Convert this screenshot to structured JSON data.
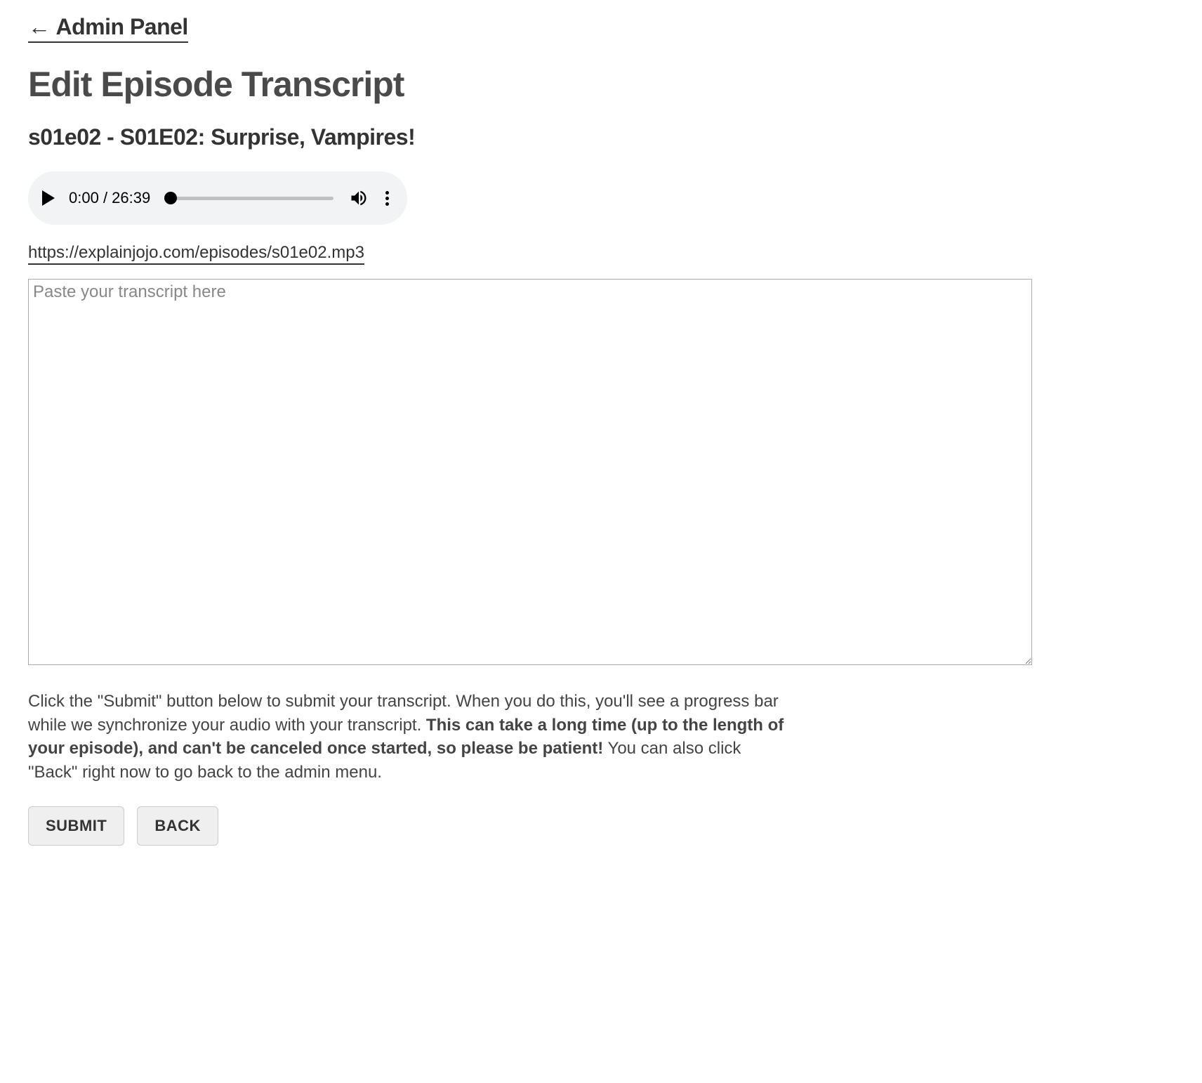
{
  "nav": {
    "back_label": "Admin Panel"
  },
  "page": {
    "title": "Edit Episode Transcript",
    "episode_title": "s01e02 - S01E02: Surprise, Vampires!"
  },
  "audio": {
    "current_time": "0:00",
    "duration": "26:39",
    "url": "https://explainjojo.com/episodes/s01e02.mp3"
  },
  "transcript": {
    "placeholder": "Paste your transcript here",
    "value": ""
  },
  "help": {
    "part1": "Click the \"Submit\" button below to submit your transcript. When you do this, you'll see a progress bar while we synchronize your audio with your transcript. ",
    "bold": "This can take a long time (up to the length of your episode), and can't be canceled once started, so please be patient!",
    "part2": " You can also click \"Back\" right now to go back to the admin menu."
  },
  "buttons": {
    "submit": "SUBMIT",
    "back": "BACK"
  }
}
